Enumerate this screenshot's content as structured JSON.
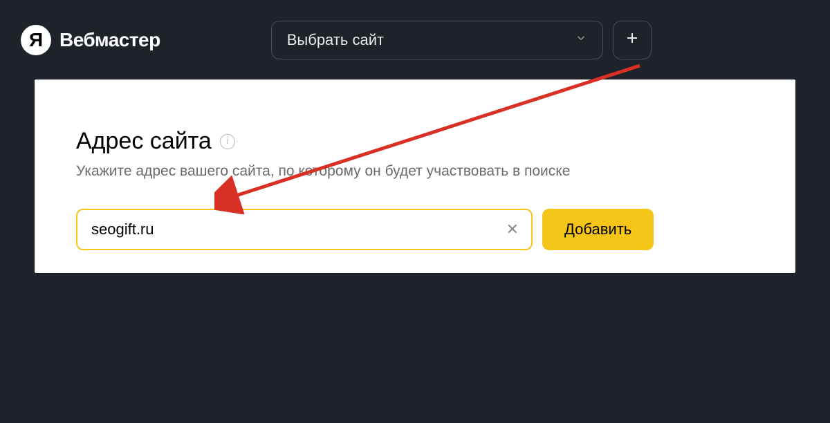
{
  "header": {
    "logo_glyph": "Я",
    "logo_text": "Вебмастер",
    "site_select_label": "Выбрать сайт"
  },
  "main": {
    "title": "Адрес сайта",
    "subtitle": "Укажите адрес вашего сайта, по которому он будет участвовать в поиске",
    "url_value": "seogift.ru",
    "add_button_label": "Добавить"
  }
}
